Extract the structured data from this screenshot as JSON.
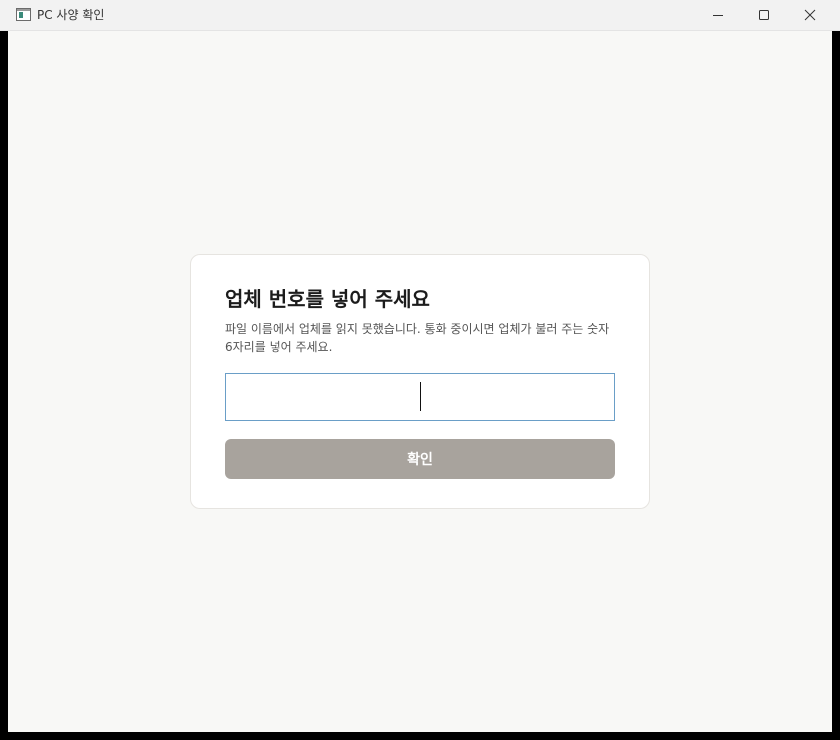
{
  "window": {
    "title": "PC 사양 확인",
    "controls": {
      "minimize_icon": "minimize-icon",
      "maximize_icon": "maximize-icon",
      "close_icon": "close-icon"
    }
  },
  "dialog": {
    "title": "업체 번호를 넣어 주세요",
    "description": "파일 이름에서 업체를 읽지 못했습니다. 통화 중이시면 업체가 불러 주는 숫자 6자리를 넣어 주세요.",
    "code_input": {
      "value": "",
      "placeholder": ""
    },
    "confirm_label": "확인"
  },
  "colors": {
    "titlebar": "#f2f2f2",
    "background": "#f8f8f6",
    "card": "#ffffff",
    "input_border": "#6a9ec7",
    "button_disabled": "#a8a39d",
    "button_text": "#ffffff"
  }
}
